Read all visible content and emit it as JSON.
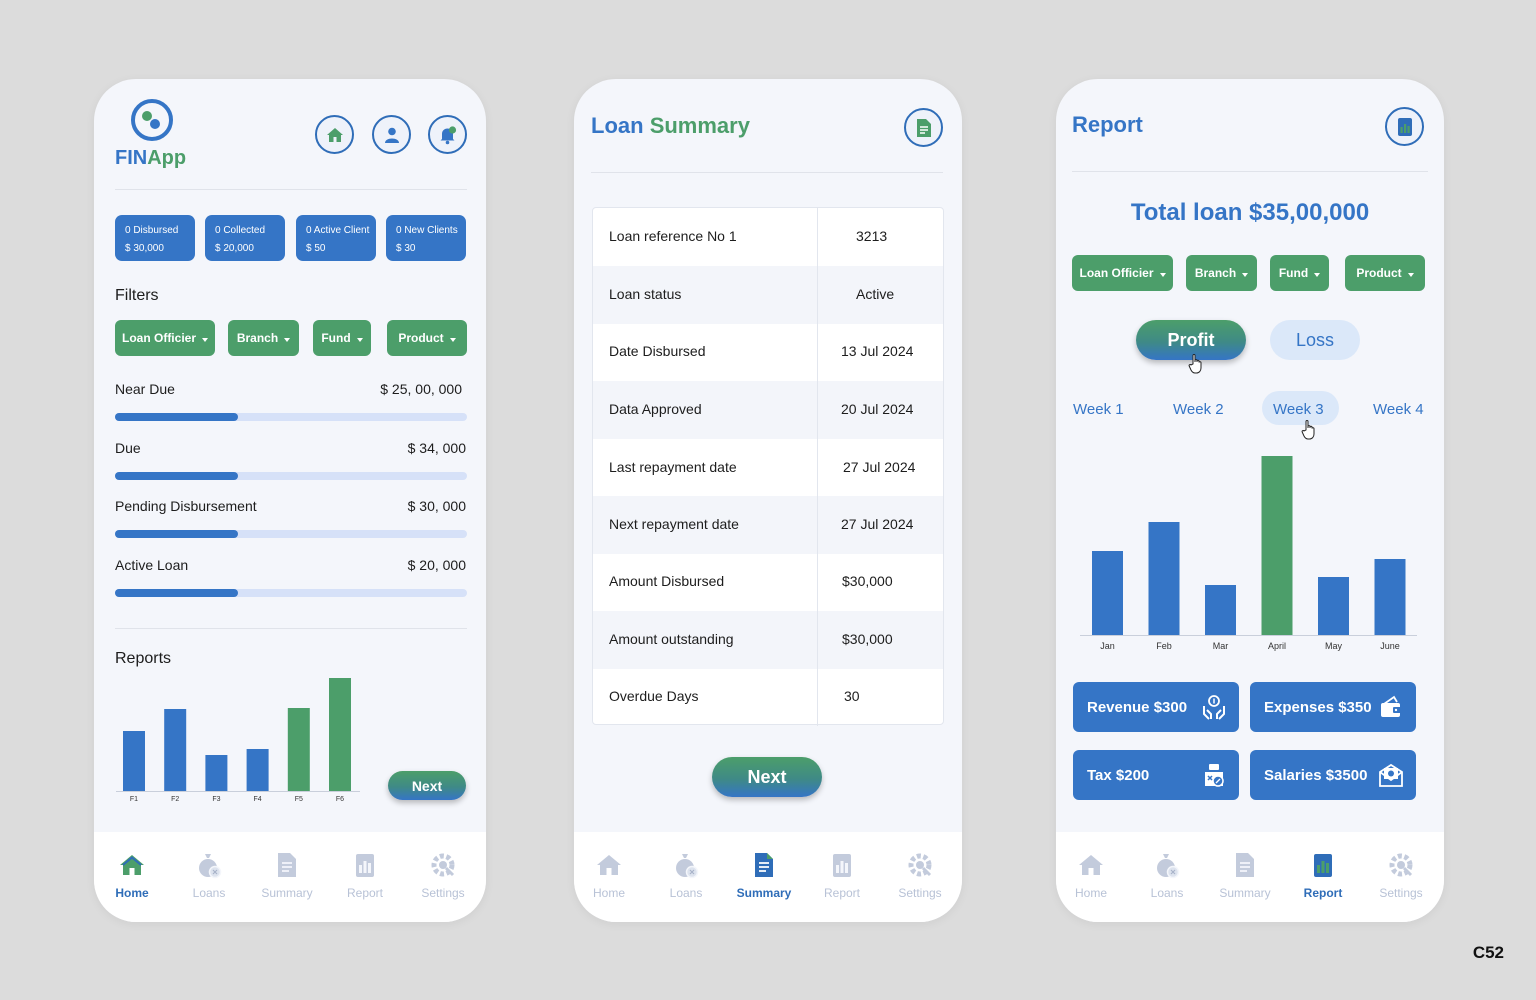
{
  "home": {
    "logo": {
      "text_fin": "FIN",
      "text_app": "App"
    },
    "stats": [
      {
        "label": "0 Disbursed",
        "value": "$ 30,000"
      },
      {
        "label": "0 Collected",
        "value": "$ 20,000"
      },
      {
        "label": "0 Active Client",
        "value": "$ 50"
      },
      {
        "label": "0 New Clients",
        "value": "$ 30"
      }
    ],
    "filters_title": "Filters",
    "filters": [
      "Loan Officier",
      "Branch",
      "Fund",
      "Product"
    ],
    "metrics": [
      {
        "label": "Near Due",
        "value": "$ 25, 00, 000",
        "progress": 0.35
      },
      {
        "label": "Due",
        "value": "$ 34, 000",
        "progress": 0.35
      },
      {
        "label": "Pending Disbursement",
        "value": "$ 30, 000",
        "progress": 0.35
      },
      {
        "label": "Active Loan",
        "value": "$ 20, 000",
        "progress": 0.35
      }
    ],
    "reports_title": "Reports",
    "next_label": "Next"
  },
  "summary": {
    "title_a": "Loan",
    "title_b": "Summary",
    "rows": [
      {
        "key": "Loan reference No 1",
        "value": "3213"
      },
      {
        "key": "Loan status",
        "value": "Active"
      },
      {
        "key": "Date Disbursed",
        "value": "13 Jul 2024"
      },
      {
        "key": "Data Approved",
        "value": "20 Jul 2024"
      },
      {
        "key": "Last repayment date",
        "value": "27 Jul 2024"
      },
      {
        "key": "Next repayment date",
        "value": "27 Jul 2024"
      },
      {
        "key": "Amount Disbursed",
        "value": "$30,000"
      },
      {
        "key": "Amount outstanding",
        "value": "$30,000"
      },
      {
        "key": "Overdue Days",
        "value": "30"
      }
    ],
    "next_label": "Next"
  },
  "report": {
    "title": "Report",
    "total": "Total loan $35,00,000",
    "filters": [
      "Loan Officier",
      "Branch",
      "Fund",
      "Product"
    ],
    "toggle": [
      "Profit",
      "Loss"
    ],
    "weeks": [
      "Week 1",
      "Week 2",
      "Week 3",
      "Week 4"
    ],
    "tiles": [
      "Revenue $300",
      "Expenses $350",
      "Tax $200",
      "Salaries $3500"
    ]
  },
  "nav": [
    "Home",
    "Loans",
    "Summary",
    "Report",
    "Settings"
  ],
  "footer_code": "C52",
  "colors": {
    "blue": "#3575c6",
    "green": "#4c9e6a",
    "track": "#d6e1f8",
    "nav_inactive": "#b8c2d6"
  },
  "chart_data": [
    {
      "type": "bar",
      "categories": [
        "F1",
        "F2",
        "F3",
        "F4",
        "F5",
        "F6"
      ],
      "values": [
        60,
        82,
        36,
        42,
        83,
        113
      ],
      "colors": [
        "#3575c6",
        "#3575c6",
        "#3575c6",
        "#3575c6",
        "#4c9e6a",
        "#4c9e6a"
      ],
      "ylim": [
        0,
        120
      ]
    },
    {
      "type": "bar",
      "categories": [
        "Jan",
        "Feb",
        "Mar",
        "April",
        "May",
        "June"
      ],
      "values": [
        84,
        113,
        50,
        179,
        58,
        76
      ],
      "colors": [
        "#3575c6",
        "#3575c6",
        "#3575c6",
        "#4c9e6a",
        "#3575c6",
        "#3575c6"
      ],
      "ylim": [
        0,
        180
      ]
    }
  ]
}
